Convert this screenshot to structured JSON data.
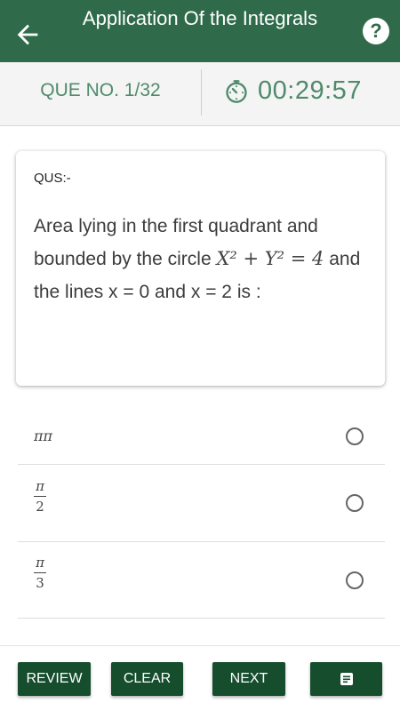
{
  "header": {
    "title": "Application Of the Integrals",
    "back_icon": "arrow-left-icon",
    "help_icon": "question-mark-icon",
    "help_glyph": "?",
    "background_color": "#2f6b4b"
  },
  "infobar": {
    "question_number": "QUE NO. 1/32",
    "timer_icon": "stopwatch-icon",
    "timer": "00:29:57",
    "text_color": "#4f8a6b"
  },
  "question": {
    "label": "QUS:-",
    "text_part1": "Area lying in the first quadrant and bounded by the circle",
    "math": "X² + Y² = 4",
    "text_part2": "and the lines x = 0 and x = 2 is :"
  },
  "options": [
    {
      "text": "ππ"
    },
    {
      "numerator": "π",
      "denominator": "2"
    },
    {
      "numerator": "π",
      "denominator": "3"
    }
  ],
  "footer": {
    "review_label": "REVIEW",
    "clear_label": "CLEAR",
    "next_label": "NEXT",
    "menu_icon": "notes-icon",
    "button_color": "#154d2d"
  }
}
